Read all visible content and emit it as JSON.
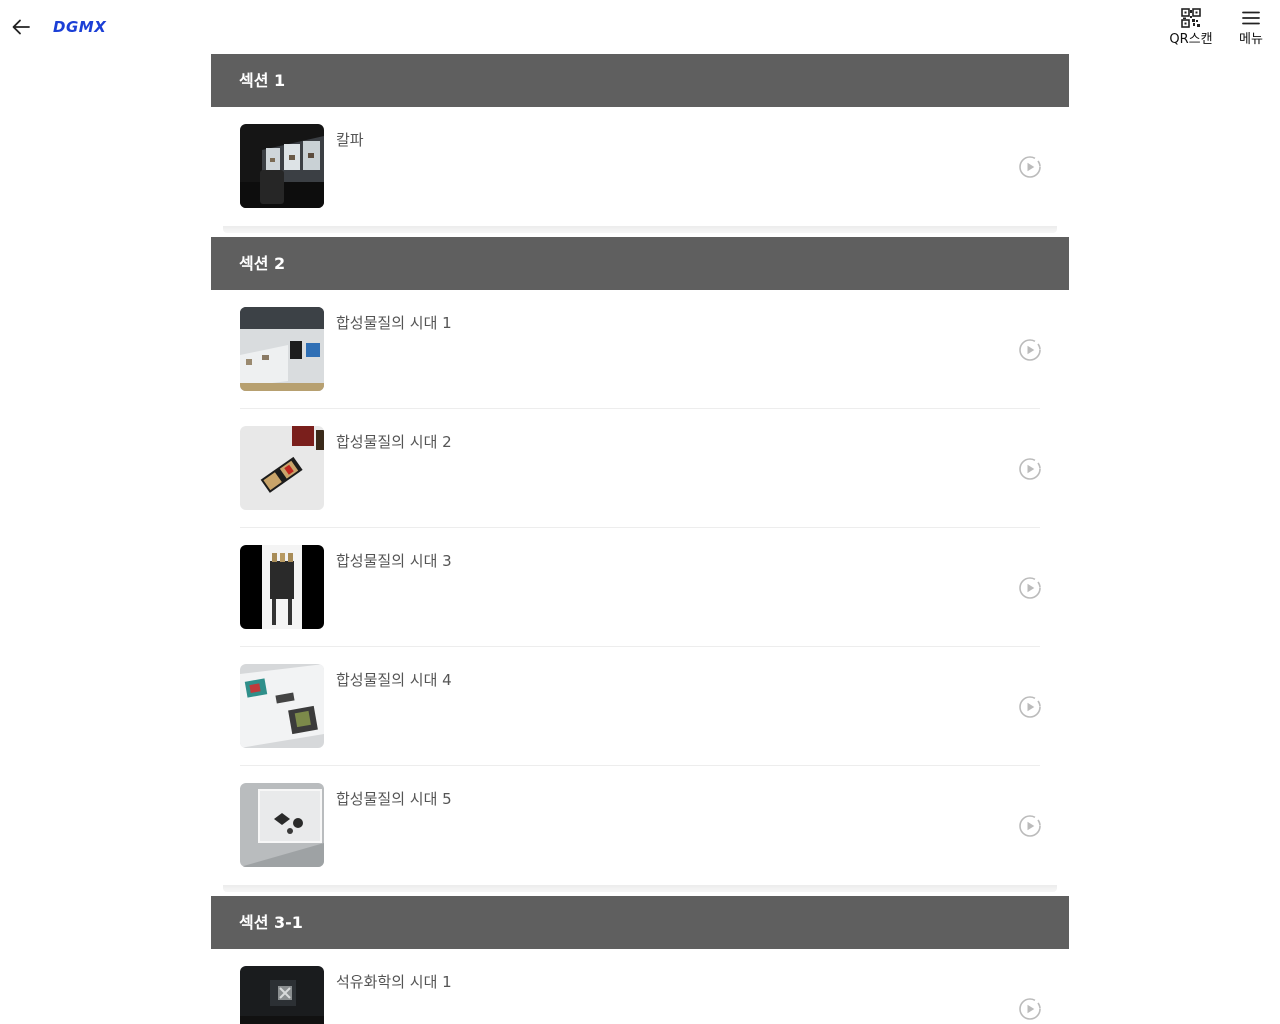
{
  "header": {
    "logo_text": "DGMX",
    "qr_label": "QR스캔",
    "menu_label": "메뉴",
    "accent_color": "#1b3fd6"
  },
  "sections": [
    {
      "title": "섹션 1",
      "items": [
        {
          "title": "칼파"
        }
      ]
    },
    {
      "title": "섹션 2",
      "items": [
        {
          "title": "합성물질의 시대 1"
        },
        {
          "title": "합성물질의 시대 2"
        },
        {
          "title": "합성물질의 시대 3"
        },
        {
          "title": "합성물질의 시대 4"
        },
        {
          "title": "합성물질의 시대 5"
        }
      ]
    },
    {
      "title": "섹션 3-1",
      "items": [
        {
          "title": "석유화학의 시대 1"
        }
      ]
    }
  ],
  "colors": {
    "section_header_bg": "#5f5f5f",
    "play_icon": "#bbbbbb"
  }
}
